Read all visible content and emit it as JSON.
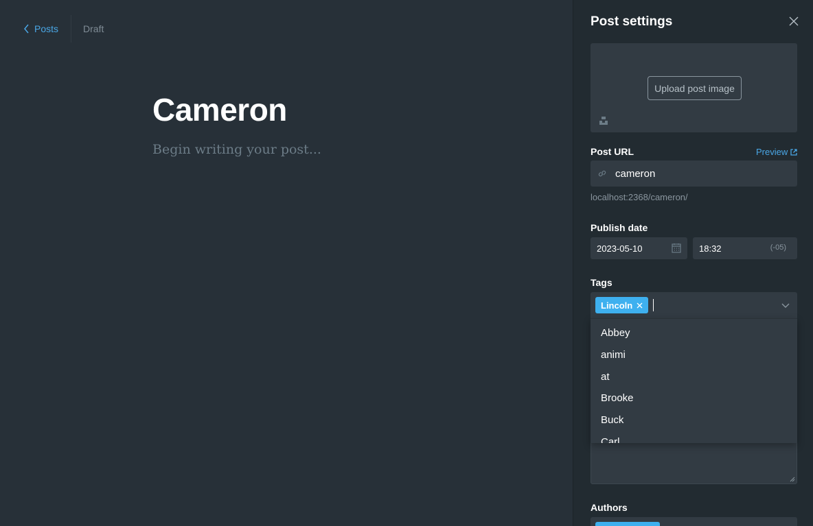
{
  "nav": {
    "back_label": "Posts",
    "status": "Draft"
  },
  "editor": {
    "title": "Cameron",
    "placeholder": "Begin writing your post..."
  },
  "sidebar": {
    "title": "Post settings",
    "upload_label": "Upload post image",
    "post_url_label": "Post URL",
    "preview_label": "Preview",
    "slug": "cameron",
    "url_hint": "localhost:2368/cameron/",
    "publish_date_label": "Publish date",
    "date": "2023-05-10",
    "time": "18:32",
    "timezone": "(-05)",
    "tags_label": "Tags",
    "selected_tag": "Lincoln",
    "tag_options": [
      "Abbey",
      "animi",
      "at",
      "Brooke",
      "Buck",
      "Carl"
    ],
    "authors_label": "Authors"
  },
  "colors": {
    "accent": "#3eb0ef",
    "link": "#4aa7e6",
    "background": "#273038",
    "sidebar": "#222b31"
  },
  "icons": [
    "chevron-left-icon",
    "close-icon",
    "unsplash-icon",
    "link-icon",
    "external-link-icon",
    "calendar-icon",
    "chevron-down-icon"
  ]
}
